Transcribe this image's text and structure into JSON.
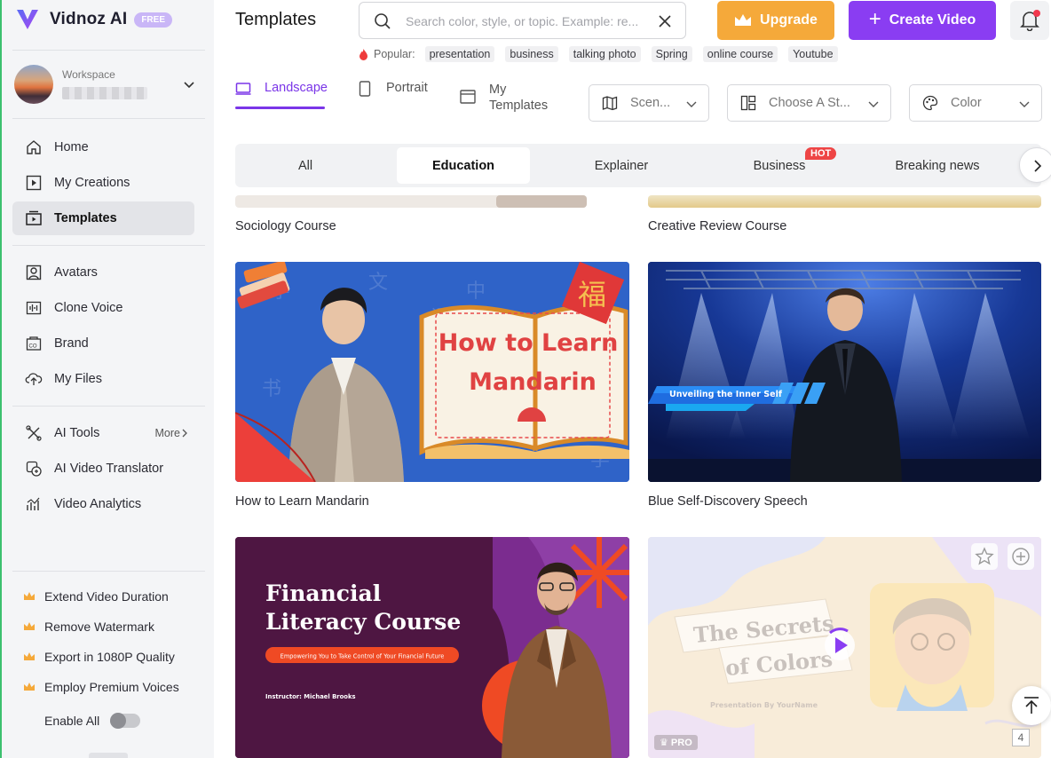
{
  "app": {
    "name": "Vidnoz AI",
    "plan_badge": "FREE"
  },
  "workspace": {
    "label": "Workspace"
  },
  "sidebar": {
    "items": [
      {
        "label": "Home",
        "icon": "home-icon"
      },
      {
        "label": "My Creations",
        "icon": "play-square-icon"
      },
      {
        "label": "Templates",
        "icon": "templates-icon",
        "active": true
      },
      {
        "label": "Avatars",
        "icon": "avatar-icon"
      },
      {
        "label": "Clone Voice",
        "icon": "waveform-icon"
      },
      {
        "label": "Brand",
        "icon": "brand-icon"
      },
      {
        "label": "My Files",
        "icon": "cloud-upload-icon"
      },
      {
        "label": "AI Tools",
        "icon": "tools-icon",
        "more": "More"
      },
      {
        "label": "AI Video Translator",
        "icon": "translate-icon"
      },
      {
        "label": "Video Analytics",
        "icon": "analytics-icon"
      }
    ],
    "promos": [
      "Extend Video Duration",
      "Remove Watermark",
      "Export in 1080P Quality",
      "Employ Premium Voices"
    ],
    "enable_all": "Enable All",
    "enable_all_on": false,
    "crown_color": "#f5a93a"
  },
  "header": {
    "title": "Templates",
    "search_placeholder": "Search color, style, or topic. Example: re...",
    "upgrade_label": "Upgrade",
    "create_label": "Create Video",
    "popular_label": "Popular:",
    "popular_tags": [
      "presentation",
      "business",
      "talking photo",
      "Spring",
      "online course",
      "Youtube"
    ]
  },
  "view_tabs": [
    {
      "label": "Landscape",
      "active": true
    },
    {
      "label": "Portrait"
    },
    {
      "label": "My Templates"
    }
  ],
  "filters": {
    "scene": "Scen...",
    "style": "Choose A St...",
    "color": "Color"
  },
  "categories": [
    {
      "label": "All"
    },
    {
      "label": "Education",
      "active": true
    },
    {
      "label": "Explainer"
    },
    {
      "label": "Business",
      "badge": "HOT"
    },
    {
      "label": "Breaking news"
    }
  ],
  "templates": [
    {
      "title": "Sociology Course"
    },
    {
      "title": "Creative Review Course"
    },
    {
      "title": "How to Learn Mandarin",
      "thumb_text": [
        "How to Learn",
        "Mandarin"
      ]
    },
    {
      "title": "Blue Self-Discovery Speech",
      "thumb_text": "Unveiling the Inner Self"
    },
    {
      "title": "Financial Literacy Course",
      "thumb_text": [
        "Financial",
        "Literacy Course"
      ],
      "thumb_subtitle": "Empowering You to Take Control of Your Financial Future",
      "thumb_footer": "Instructor: Michael Brooks"
    },
    {
      "title": "The Secrets of Colors",
      "thumb_text": [
        "The Secrets",
        "of Colors"
      ],
      "thumb_footer": "Presentation By YourName",
      "badge": "PRO"
    }
  ],
  "pager": {
    "count": "4"
  },
  "colors": {
    "brand": "#8a3df2",
    "upgrade": "#f5a93a",
    "hot": "#ee4545",
    "accent_tab": "#7a35e8"
  }
}
